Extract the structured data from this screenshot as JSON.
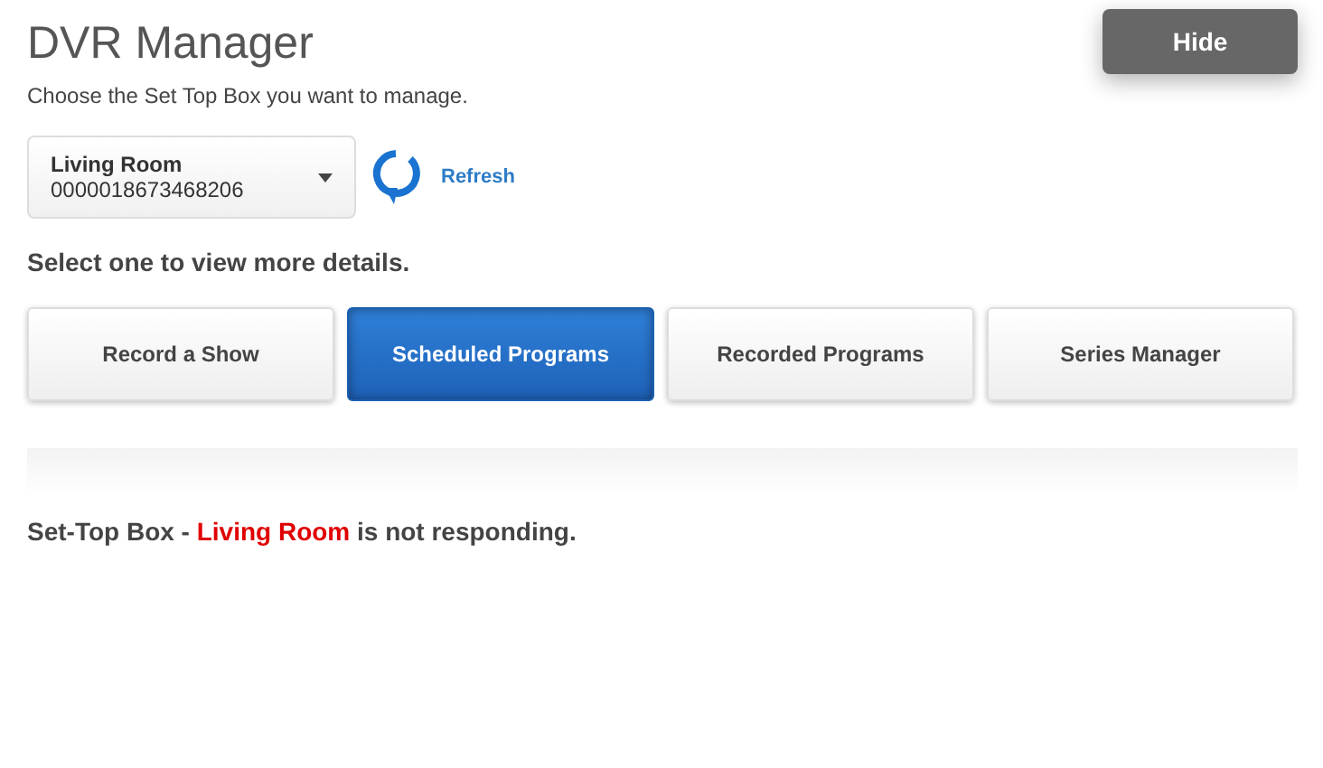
{
  "title": "DVR Manager",
  "hide_button": "Hide",
  "instruction": "Choose the Set Top Box you want to manage.",
  "device_select": {
    "name": "Living Room",
    "serial": "0000018673468206"
  },
  "refresh": "Refresh",
  "section_label": "Select one to view more details.",
  "tabs": [
    {
      "label": "Record a Show",
      "selected": false
    },
    {
      "label": "Scheduled Programs",
      "selected": true
    },
    {
      "label": "Recorded Programs",
      "selected": false
    },
    {
      "label": "Series Manager",
      "selected": false
    }
  ],
  "status_message": {
    "prefix": "Set-Top Box - ",
    "device": "Living Room",
    "suffix": " is not responding."
  }
}
